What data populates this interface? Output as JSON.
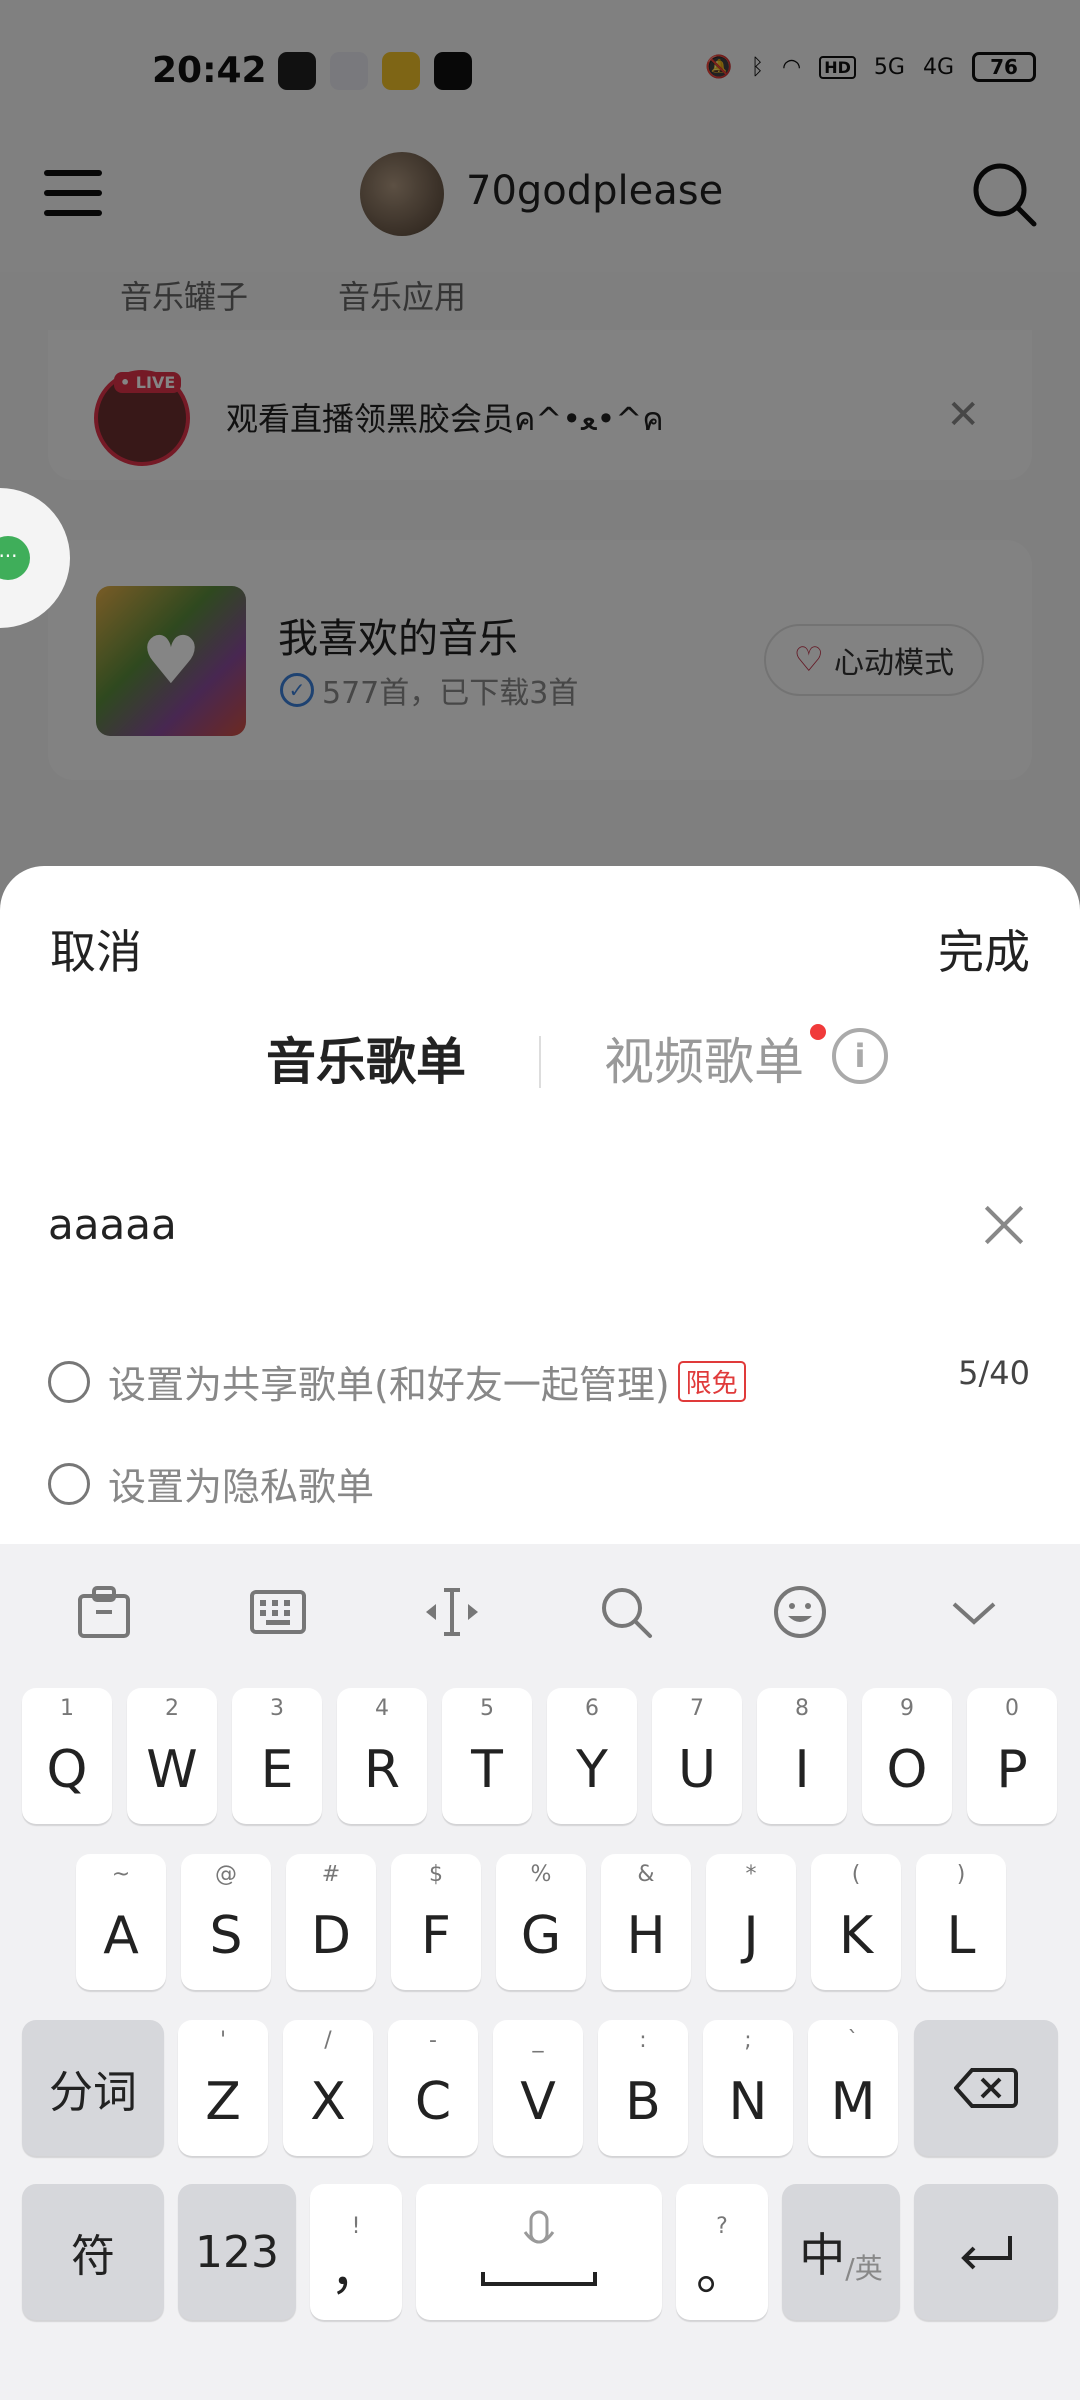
{
  "status": {
    "time": "20:42",
    "network_hd": "HD",
    "net1": "5G",
    "net2": "4G",
    "battery": "76"
  },
  "header": {
    "username": "70godplease"
  },
  "bg": {
    "tabs": [
      "音乐罐子",
      "音乐应用"
    ],
    "live_text": "观看直播领黑胶会员ค^•ﻌ•^ค",
    "live_badge": "• LIVE",
    "fav_title": "我喜欢的音乐",
    "fav_sub": "577首，已下载3首",
    "heart_mode": "心动模式"
  },
  "sheet": {
    "cancel": "取消",
    "done": "完成",
    "tab_music": "音乐歌单",
    "tab_video": "视频歌单",
    "playlist_name": "aaaaa",
    "option_shared": "设置为共享歌单(和好友一起管理)",
    "shared_badge": "限免",
    "counter": "5/40",
    "option_private": "设置为隐私歌单"
  },
  "keyboard": {
    "row1": [
      {
        "k": "Q",
        "s": "1"
      },
      {
        "k": "W",
        "s": "2"
      },
      {
        "k": "E",
        "s": "3"
      },
      {
        "k": "R",
        "s": "4"
      },
      {
        "k": "T",
        "s": "5"
      },
      {
        "k": "Y",
        "s": "6"
      },
      {
        "k": "U",
        "s": "7"
      },
      {
        "k": "I",
        "s": "8"
      },
      {
        "k": "O",
        "s": "9"
      },
      {
        "k": "P",
        "s": "0"
      }
    ],
    "row2": [
      {
        "k": "A",
        "s": "~"
      },
      {
        "k": "S",
        "s": "@"
      },
      {
        "k": "D",
        "s": "#"
      },
      {
        "k": "F",
        "s": "$"
      },
      {
        "k": "G",
        "s": "%"
      },
      {
        "k": "H",
        "s": "&"
      },
      {
        "k": "J",
        "s": "*"
      },
      {
        "k": "K",
        "s": "("
      },
      {
        "k": "L",
        "s": ")"
      }
    ],
    "row3": [
      {
        "k": "Z",
        "s": "'"
      },
      {
        "k": "X",
        "s": "/"
      },
      {
        "k": "C",
        "s": "-"
      },
      {
        "k": "V",
        "s": "_"
      },
      {
        "k": "B",
        "s": ":"
      },
      {
        "k": "N",
        "s": ";"
      },
      {
        "k": "M",
        "s": "`"
      }
    ],
    "segment_key": "分词",
    "symbol_key": "符",
    "num_key": "123",
    "comma_key": "，",
    "comma_sub": "!",
    "period_key": "。",
    "period_sub": "?",
    "lang_key": "中",
    "lang_sub": "/英"
  }
}
